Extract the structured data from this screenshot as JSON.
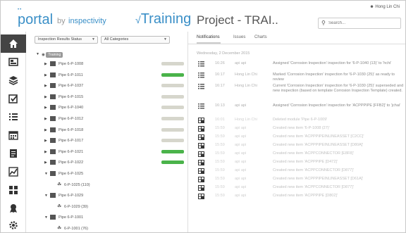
{
  "header": {
    "logo_dots": "••",
    "logo_portal": "portal",
    "logo_by": "by",
    "logo_company": "inspectivity",
    "module_tick": "√",
    "module_title": "Training",
    "project_title": "Project - TRAI..",
    "user_name": "Hong Lin Chi",
    "search_placeholder": "Search..."
  },
  "nav": {
    "items": [
      {
        "name": "home-icon",
        "active": true
      },
      {
        "name": "dashboard-icon"
      },
      {
        "name": "layers-icon"
      },
      {
        "name": "checklist-icon"
      },
      {
        "name": "list-icon"
      },
      {
        "name": "calendar-icon"
      },
      {
        "name": "document-icon"
      },
      {
        "name": "chart-icon"
      },
      {
        "name": "grid-icon"
      },
      {
        "name": "award-icon"
      },
      {
        "name": "settings-icon"
      }
    ]
  },
  "filters": {
    "status": "Inspection Results Status",
    "category": "All Categories"
  },
  "tree": {
    "root": "Training",
    "rows": [
      {
        "label": "Pipe 6-P-1008",
        "progress": 0
      },
      {
        "label": "Pipe 6-P-1011",
        "progress": 1
      },
      {
        "label": "Pipe 6-P-1037",
        "progress": 0
      },
      {
        "label": "Pipe 6-P-1015",
        "progress": 0
      },
      {
        "label": "Pipe 6-P-1040",
        "progress": 0
      },
      {
        "label": "Pipe 6-P-1012",
        "progress": 0
      },
      {
        "label": "Pipe 6-P-1018",
        "progress": 0
      },
      {
        "label": "Pipe 6-P-1017",
        "progress": 0
      },
      {
        "label": "Pipe 6-P-1021",
        "progress": 1
      },
      {
        "label": "Pipe 6-P-1022",
        "progress": 1
      },
      {
        "label": "Pipe 6-P-1025",
        "progress": 0
      },
      {
        "label": "6-P-1025 (110)",
        "progress": 0
      },
      {
        "label": "Pipe 6-P-1029",
        "progress": 0
      },
      {
        "label": "6-P-1029 (39)",
        "progress": 0
      },
      {
        "label": "Pipe 6-P-1001",
        "progress": 0
      },
      {
        "label": "6-P-1001 (76)",
        "progress": 0
      }
    ]
  },
  "tabs": [
    "Notifications",
    "Issues",
    "Charts"
  ],
  "log": {
    "date_header": "Wednesday, 2 December 2015",
    "entries": [
      {
        "icon": "list-icon",
        "time": "16:26",
        "user": "api api",
        "msg": "Assigned 'Corrosion Inspection' inspection for '6-P-1040 (13)' to 'hchi'"
      },
      {
        "icon": "list-icon",
        "time": "16:17",
        "user": "Hong Lin Chi",
        "msg": "Marked 'Corrosion Inspection' inspection for '6-P-1030 (25)' as ready to review"
      },
      {
        "icon": "list-icon",
        "time": "16:17",
        "user": "Hong Lin Chi",
        "msg": "Current 'Corrosion Inspection' inspection for '6-P-1030 (25)' superseded and new inspection (based on template Corrosion Inspection Template) created."
      },
      {
        "icon": "list-icon",
        "time": "16:13",
        "user": "api api",
        "msg": "Assigned 'Corrosion Inspection' inspection for 'ACPPPIPE [FFB2]' to 'jchai'"
      },
      {
        "icon": "grid-icon",
        "time": "16:01",
        "user": "Hong Lin Chi",
        "msg": "Deleted module 'Pipe 6-P-1009'",
        "faded": true
      },
      {
        "icon": "grid-icon",
        "time": "15:59",
        "user": "api api",
        "msg": "Created new item '6-P-1008 (27)'",
        "faded": true
      },
      {
        "icon": "grid-icon",
        "time": "15:59",
        "user": "api api",
        "msg": "Created new item 'ACPPPIPEINLINEASSET [C2CC]'",
        "faded": true
      },
      {
        "icon": "grid-icon",
        "time": "15:59",
        "user": "api api",
        "msg": "Created new item 'ACPPPIPEINLINEASSET [D80A]'",
        "faded": true
      },
      {
        "icon": "grid-icon",
        "time": "15:59",
        "user": "api api",
        "msg": "Created new item 'ACPPCONNECTOR [E8F8]'",
        "faded": true
      },
      {
        "icon": "grid-icon",
        "time": "15:59",
        "user": "api api",
        "msg": "Created new item 'ACPPPIPE [D472]'",
        "faded": true
      },
      {
        "icon": "grid-icon",
        "time": "15:59",
        "user": "api api",
        "msg": "Created new item 'ACPPCONNECTOR [D877]'",
        "faded": true
      },
      {
        "icon": "grid-icon",
        "time": "15:59",
        "user": "api api",
        "msg": "Created new item 'ACPPPIPEINLINEASSET [D61A]'",
        "faded": true
      },
      {
        "icon": "grid-icon",
        "time": "15:59",
        "user": "api api",
        "msg": "Created new item 'ACPPCONNECTOR [D877]'",
        "faded": true
      },
      {
        "icon": "grid-icon",
        "time": "15:59",
        "user": "api api",
        "msg": "Created new item 'ACPPPIPE [D802]'",
        "faded": true
      }
    ]
  }
}
